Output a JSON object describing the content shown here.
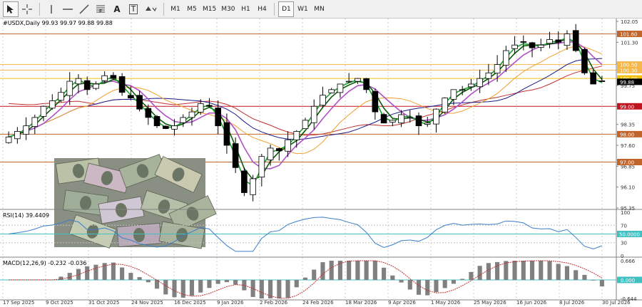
{
  "toolbar": {
    "tools": [
      {
        "name": "cursor-tool",
        "icon": "arrow-cursor-icon",
        "label": ""
      },
      {
        "name": "crosshair-tool",
        "icon": "crosshair-icon",
        "label": ""
      },
      {
        "name": "vertical-line-tool",
        "icon": "vertical-line-icon",
        "label": ""
      },
      {
        "name": "horizontal-line-tool",
        "icon": "horizontal-line-icon",
        "label": ""
      },
      {
        "name": "trendline-tool",
        "icon": "trendline-icon",
        "label": ""
      },
      {
        "name": "fibonacci-tool",
        "icon": "fibonacci-icon",
        "label": ""
      },
      {
        "name": "text-tool",
        "icon": "text-icon",
        "label": "A"
      },
      {
        "name": "text-label-tool",
        "icon": "text-label-icon",
        "label": "T"
      },
      {
        "name": "shapes-tool",
        "icon": "shapes-icon",
        "label": ""
      }
    ],
    "timeframes": [
      "M1",
      "M5",
      "M15",
      "M30",
      "H1",
      "H4",
      "D1",
      "W1",
      "MN"
    ],
    "active_timeframe": "D1"
  },
  "chart": {
    "header": "#USDX,Daily  99.93 99.97 99.88 99.88",
    "price_labels": [
      "102.05",
      "101.30",
      "100.55",
      "99.75",
      "99.00",
      "98.35",
      "97.60",
      "96.85",
      "96.10",
      "95.35"
    ],
    "level_tags": [
      {
        "text": "101.60",
        "price": 101.6,
        "color": "#c0642a"
      },
      {
        "text": "100.50",
        "price": 100.5,
        "color": "#f5b74a"
      },
      {
        "text": "100.30",
        "price": 100.3,
        "color": "#f5b74a"
      },
      {
        "text": "100.00",
        "price": 100.0,
        "color": "#f2c00a"
      },
      {
        "text": "99.88",
        "price": 99.88,
        "color": "#000000"
      },
      {
        "text": "99.00",
        "price": 99.0,
        "color": "#c0141e"
      },
      {
        "text": "98.00",
        "price": 98.0,
        "color": "#c0642a"
      },
      {
        "text": "97.00",
        "price": 97.0,
        "color": "#c0642a"
      }
    ],
    "date_labels": [
      "17 Sep 2025",
      "9 Oct 2025",
      "31 Oct 2025",
      "24 Nov 2025",
      "16 Dec 2025",
      "9 Jan 2026",
      "2 Feb 2026",
      "24 Feb 2026",
      "18 Mar 2026",
      "9 Apr 2026",
      "1 May 2026",
      "25 May 2026",
      "16 Jun 2026",
      "8 Jul 2026",
      "30 Jul 2026"
    ]
  },
  "rsi": {
    "header": "RSI(14) 39.4409",
    "labels": [
      "100",
      "70",
      "50.0000",
      "30",
      "0"
    ],
    "level_value": "50.0000"
  },
  "macd": {
    "header": "MACD(12,26,9) -0.232 -0.036",
    "labels": [
      "0.666",
      "0.000",
      "-0.644"
    ]
  },
  "colors": {
    "up_candle": "#000000",
    "down_candle": "#000000",
    "ma_fast": "#19a02a",
    "ma_mid": "#0a5a0a",
    "ma_purple": "#b050c8",
    "ma_orange": "#f0a030",
    "ma_blue": "#1a1a8c",
    "ma_red": "#c03030",
    "rsi_line": "#3a7ec8",
    "macd_hist": "#808080",
    "macd_signal": "#c03030",
    "level_line": "#40c0c0"
  },
  "chart_data": {
    "type": "candlestick",
    "symbol": "#USDX",
    "timeframe": "Daily",
    "last_bar": {
      "open": 99.93,
      "high": 99.97,
      "low": 99.88,
      "close": 99.88
    },
    "ylim": [
      95.35,
      102.05
    ],
    "x": [
      "17 Sep 2025",
      "21 Sep 2025",
      "25 Sep 2025",
      "29 Sep 2025",
      "3 Oct 2025",
      "7 Oct 2025",
      "11 Oct 2025",
      "15 Oct 2025",
      "19 Oct 2025",
      "23 Oct 2025",
      "27 Oct 2025",
      "31 Oct 2025",
      "4 Nov 2025",
      "8 Nov 2025",
      "12 Nov 2025",
      "16 Nov 2025",
      "20 Nov 2025",
      "24 Nov 2025",
      "28 Nov 2025",
      "2 Dec 2025",
      "6 Dec 2025",
      "10 Dec 2025",
      "14 Dec 2025",
      "18 Dec 2025",
      "22 Dec 2025",
      "26 Dec 2025",
      "30 Dec 2025",
      "3 Jan 2026",
      "7 Jan 2026",
      "11 Jan 2026",
      "15 Jan 2026",
      "19 Jan 2026",
      "23 Jan 2026",
      "27 Jan 2026",
      "31 Jan 2026",
      "4 Feb 2026",
      "8 Feb 2026",
      "12 Feb 2026",
      "16 Feb 2026",
      "20 Feb 2026",
      "24 Feb 2026",
      "28 Feb 2026",
      "4 Mar 2026",
      "8 Mar 2026",
      "12 Mar 2026",
      "16 Mar 2026",
      "20 Mar 2026",
      "24 Mar 2026",
      "28 Mar 2026",
      "1 Apr 2026",
      "5 Apr 2026",
      "9 Apr 2026",
      "13 Apr 2026",
      "17 Apr 2026",
      "21 Apr 2026",
      "25 Apr 2026",
      "29 Apr 2026",
      "3 May 2026",
      "7 May 2026",
      "11 May 2026",
      "15 May 2026",
      "19 May 2026",
      "23 May 2026",
      "27 May 2026",
      "31 May 2026",
      "4 Jun 2026",
      "8 Jun 2026",
      "12 Jun 2026",
      "16 Jun 2026",
      "20 Jun 2026",
      "24 Jun 2026",
      "28 Jun 2026",
      "2 Jul 2026",
      "6 Jul 2026",
      "10 Jul 2026",
      "14 Jul 2026",
      "18 Jul 2026",
      "22 Jul 2026",
      "26 Jul 2026",
      "30 Jul 2026",
      "3 Aug 2026"
    ],
    "series": [
      {
        "name": "close",
        "values": [
          97.9,
          98.1,
          98.3,
          98.6,
          99.0,
          99.2,
          99.5,
          99.9,
          100.0,
          99.6,
          99.8,
          100.1,
          100.0,
          99.5,
          99.3,
          98.9,
          98.6,
          98.3,
          98.2,
          98.3,
          98.6,
          98.8,
          99.1,
          99.0,
          98.3,
          97.6,
          96.8,
          95.9,
          96.4,
          97.2,
          97.5,
          97.4,
          97.8,
          98.1,
          98.5,
          99.0,
          99.4,
          99.6,
          99.8,
          99.9,
          100.0,
          99.6,
          98.8,
          98.4,
          98.5,
          98.7,
          98.6,
          98.3,
          98.4,
          98.9,
          99.3,
          99.6,
          99.6,
          99.8,
          100.0,
          100.2,
          100.5,
          101.0,
          101.2,
          101.3,
          101.1,
          101.2,
          101.4,
          101.3,
          101.6,
          101.0,
          100.2,
          99.8,
          99.9
        ]
      }
    ],
    "indicators": {
      "rsi_period": 14,
      "rsi_last": 39.4409,
      "rsi_levels": [
        70,
        50,
        30
      ],
      "macd_params": [
        12,
        26,
        9
      ],
      "macd_last": -0.232,
      "macd_signal_last": -0.036
    }
  }
}
